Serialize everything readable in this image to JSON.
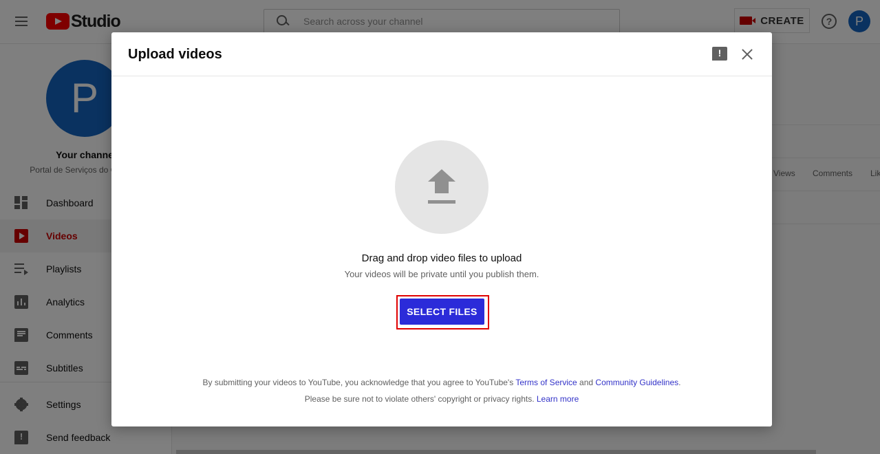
{
  "topbar": {
    "logo_text": "Studio",
    "search_placeholder": "Search across your channel",
    "create_label": "CREATE",
    "help_symbol": "?",
    "avatar_initial": "P"
  },
  "sidebar": {
    "avatar_initial": "P",
    "channel_title": "Your channel",
    "channel_subtitle": "Portal de Serviços do Governo",
    "items": [
      {
        "label": "Dashboard",
        "icon": "dashboard-icon"
      },
      {
        "label": "Videos",
        "icon": "videos-icon",
        "active": true
      },
      {
        "label": "Playlists",
        "icon": "playlists-icon"
      },
      {
        "label": "Analytics",
        "icon": "analytics-icon"
      },
      {
        "label": "Comments",
        "icon": "comments-icon"
      },
      {
        "label": "Subtitles",
        "icon": "subtitles-icon"
      },
      {
        "label": "Settings",
        "icon": "gear-icon"
      },
      {
        "label": "Send feedback",
        "icon": "feedback-icon"
      }
    ]
  },
  "background_table": {
    "columns": [
      "Views",
      "Comments",
      "Lik"
    ]
  },
  "dialog": {
    "title": "Upload videos",
    "drag_text": "Drag and drop video files to upload",
    "private_text": "Your videos will be private until you publish them.",
    "select_button": "SELECT FILES",
    "legal_prefix": "By submitting your videos to YouTube, you acknowledge that you agree to YouTube's ",
    "terms_link": "Terms of Service",
    "legal_and": " and ",
    "guidelines_link": "Community Guidelines",
    "legal_period": ".",
    "copyright_text": "Please be sure not to violate others' copyright or privacy rights. ",
    "learn_more_link": "Learn more"
  },
  "colors": {
    "brand_red": "#ff0000",
    "active_red": "#cc0000",
    "primary_button": "#2b2bd9",
    "highlight_border": "#e00000",
    "link": "#3232c8",
    "avatar_blue": "#1565c0"
  }
}
